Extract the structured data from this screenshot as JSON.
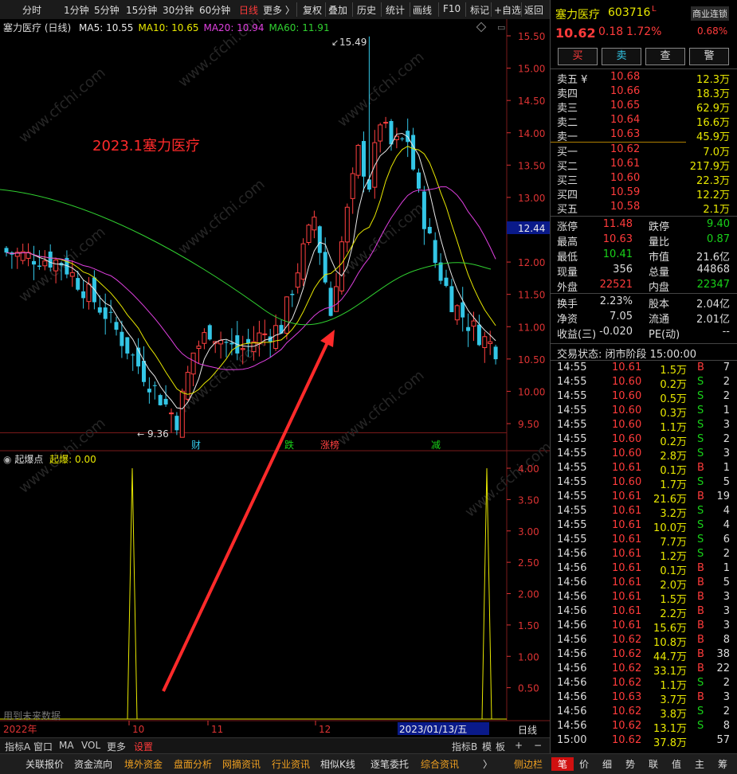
{
  "toolbar": {
    "timeframes": [
      "分时",
      "1分钟",
      "5分钟",
      "15分钟",
      "30分钟",
      "60分钟",
      "日线",
      "更多 〉"
    ],
    "active": "日线",
    "tools": [
      "复权",
      "叠加",
      "历史",
      "统计",
      "画线",
      "F10",
      "标记",
      "+自选",
      "返回"
    ]
  },
  "chart": {
    "title": "塞力医疗 (日线)",
    "ma": [
      {
        "label": "MA5: 10.55",
        "color": "#e8e8e8"
      },
      {
        "label": "MA10: 10.65",
        "color": "#e8e800"
      },
      {
        "label": "MA20: 10.94",
        "color": "#e040e0"
      },
      {
        "label": "MA60: 11.91",
        "color": "#30d030"
      }
    ],
    "annotation": "2023.1塞力医疗",
    "high_label": "15.49",
    "low_label": "9.36",
    "current_price_tag": "12.44",
    "event_markers": [
      "财",
      "跌",
      "涨榜",
      "减"
    ],
    "price_axis": [
      "15.50",
      "15.00",
      "14.50",
      "14.00",
      "13.50",
      "13.00",
      "12.50",
      "12.00",
      "11.50",
      "11.00",
      "10.50",
      "10.00",
      "9.50"
    ],
    "indicator": {
      "name": "起爆点",
      "value_label": "起爆: 0.00",
      "axis": [
        "4.00",
        "3.50",
        "3.00",
        "2.50",
        "2.00",
        "1.50",
        "1.00",
        "0.50"
      ]
    },
    "future_data_note": "用到未来数据",
    "x_axis": [
      "2022年",
      "10",
      "11",
      "12",
      "2023/01/13/五"
    ],
    "x_unit": "日线",
    "watermark": "www.cfchi.com"
  },
  "chart_data": {
    "type": "line",
    "indicator_spikes": [
      {
        "position": "early October 2022",
        "value": 4.0
      },
      {
        "position": "2023/01/13",
        "value": 4.0
      }
    ]
  },
  "tabs": {
    "left": [
      "指标A",
      "窗口",
      "MA",
      "VOL",
      "更多",
      "设置"
    ],
    "right": [
      "指标B",
      "模",
      "板",
      "+",
      "−"
    ]
  },
  "bottom_bar": [
    "关联报价",
    "资金流向",
    "境外资金",
    "盘面分析",
    "网摘资讯",
    "行业资讯",
    "相似K线",
    "逐笔委托",
    "综合资讯",
    "〉",
    "侧边栏",
    "笔",
    "价",
    "细",
    "势",
    "联",
    "值",
    "主",
    "筹"
  ],
  "quote": {
    "name": "塞力医疗",
    "code": "603716",
    "flag": "L",
    "sector": "商业连锁",
    "sector_change": "0.68%",
    "price": "10.62",
    "change": "0.18",
    "pct": "1.72%",
    "buttons": [
      "买",
      "卖",
      "查",
      "警"
    ],
    "asks": [
      {
        "label": "卖五 ¥",
        "price": "10.68",
        "vol": "12.3万"
      },
      {
        "label": "卖四",
        "price": "10.66",
        "vol": "18.3万"
      },
      {
        "label": "卖三",
        "price": "10.65",
        "vol": "62.9万"
      },
      {
        "label": "卖二",
        "price": "10.64",
        "vol": "16.6万"
      },
      {
        "label": "卖一",
        "price": "10.63",
        "vol": "45.9万"
      }
    ],
    "bids": [
      {
        "label": "买一",
        "price": "10.62",
        "vol": "7.0万"
      },
      {
        "label": "买二",
        "price": "10.61",
        "vol": "217.9万"
      },
      {
        "label": "买三",
        "price": "10.60",
        "vol": "22.3万"
      },
      {
        "label": "买四",
        "price": "10.59",
        "vol": "12.2万"
      },
      {
        "label": "买五",
        "price": "10.58",
        "vol": "2.1万"
      }
    ],
    "stats": [
      {
        "k1": "涨停",
        "v1": "11.48",
        "c1": "red",
        "k2": "跌停",
        "v2": "9.40",
        "c2": "grn"
      },
      {
        "k1": "最高",
        "v1": "10.63",
        "c1": "red",
        "k2": "量比",
        "v2": "0.87",
        "c2": "grn"
      },
      {
        "k1": "最低",
        "v1": "10.41",
        "c1": "grn",
        "k2": "市值",
        "v2": "21.6亿",
        "c2": "wht"
      },
      {
        "k1": "现量",
        "v1": "356",
        "c1": "wht",
        "k2": "总量",
        "v2": "44868",
        "c2": "wht"
      },
      {
        "k1": "外盘",
        "v1": "22521",
        "c1": "red",
        "k2": "内盘",
        "v2": "22347",
        "c2": "grn"
      }
    ],
    "stats2": [
      {
        "k1": "换手",
        "v1": "2.23%",
        "k2": "股本",
        "v2": "2.04亿"
      },
      {
        "k1": "净资",
        "v1": "7.05",
        "k2": "流通",
        "v2": "2.01亿"
      },
      {
        "k1": "收益(三)",
        "v1": "-0.020",
        "k2": "PE(动)",
        "v2": "--"
      }
    ],
    "status": "交易状态: 闭市阶段 15:00:00"
  },
  "ticks": [
    [
      "14:55",
      "10.61",
      "1.5万",
      "B",
      "7"
    ],
    [
      "14:55",
      "10.60",
      "0.2万",
      "S",
      "2"
    ],
    [
      "14:55",
      "10.60",
      "0.5万",
      "S",
      "2"
    ],
    [
      "14:55",
      "10.60",
      "0.3万",
      "S",
      "1"
    ],
    [
      "14:55",
      "10.60",
      "1.1万",
      "S",
      "3"
    ],
    [
      "14:55",
      "10.60",
      "0.2万",
      "S",
      "2"
    ],
    [
      "14:55",
      "10.60",
      "2.8万",
      "S",
      "3"
    ],
    [
      "14:55",
      "10.61",
      "0.1万",
      "B",
      "1"
    ],
    [
      "14:55",
      "10.60",
      "1.7万",
      "S",
      "5"
    ],
    [
      "14:55",
      "10.61",
      "21.6万",
      "B",
      "19"
    ],
    [
      "14:55",
      "10.61",
      "3.2万",
      "S",
      "4"
    ],
    [
      "14:55",
      "10.61",
      "10.0万",
      "S",
      "4"
    ],
    [
      "14:55",
      "10.61",
      "7.7万",
      "S",
      "6"
    ],
    [
      "14:56",
      "10.61",
      "1.2万",
      "S",
      "2"
    ],
    [
      "14:56",
      "10.61",
      "0.1万",
      "B",
      "1"
    ],
    [
      "14:56",
      "10.61",
      "2.0万",
      "B",
      "5"
    ],
    [
      "14:56",
      "10.61",
      "1.5万",
      "B",
      "3"
    ],
    [
      "14:56",
      "10.61",
      "2.2万",
      "B",
      "3"
    ],
    [
      "14:56",
      "10.61",
      "15.6万",
      "B",
      "3"
    ],
    [
      "14:56",
      "10.62",
      "10.8万",
      "B",
      "8"
    ],
    [
      "14:56",
      "10.62",
      "44.7万",
      "B",
      "38"
    ],
    [
      "14:56",
      "10.62",
      "33.1万",
      "B",
      "22"
    ],
    [
      "14:56",
      "10.62",
      "1.1万",
      "S",
      "2"
    ],
    [
      "14:56",
      "10.63",
      "3.7万",
      "B",
      "3"
    ],
    [
      "14:56",
      "10.62",
      "3.8万",
      "S",
      "2"
    ],
    [
      "14:56",
      "10.62",
      "13.1万",
      "S",
      "8"
    ],
    [
      "15:00",
      "10.62",
      "37.8万",
      "",
      "57"
    ]
  ]
}
